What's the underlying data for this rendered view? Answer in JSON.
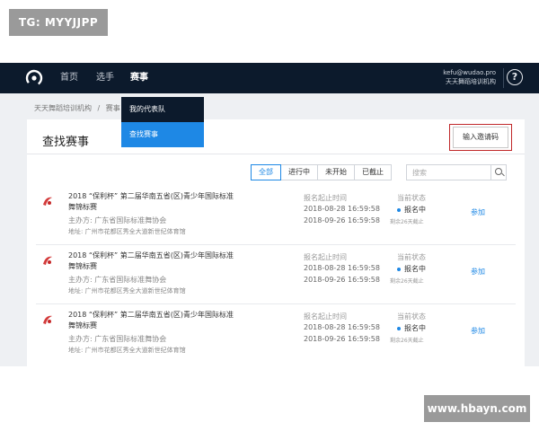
{
  "watermarks": {
    "top": "TG: MYYJJPP",
    "bottom": "www.hbayn.com"
  },
  "navbar": {
    "items": [
      "首页",
      "选手",
      "赛事"
    ],
    "user_email": "kefu@wudao.pro",
    "user_org": "天天舞蹈培训机构",
    "help_symbol": "?"
  },
  "dropdown": {
    "items": [
      "我的代表队",
      "查找赛事"
    ]
  },
  "breadcrumb": {
    "items": [
      "天天舞蹈培训机构",
      "/",
      "赛事"
    ]
  },
  "page": {
    "title": "查找赛事",
    "invite_button": "输入邀请码",
    "filters": [
      "全部",
      "进行中",
      "未开始",
      "已截止"
    ],
    "search_placeholder": "搜索"
  },
  "events": [
    {
      "title": "2018 “保利杯” 第二届华南五省(区)青少年国际标准舞锦标赛",
      "host": "主办方: 广东省国际标准舞协会",
      "address": "地址: 广州市花都区秀全大道新世纪体育馆",
      "reg_label": "报名起止时间",
      "reg_start": "2018-08-28 16:59:58",
      "reg_end": "2018-09-26 16:59:58",
      "status_label": "当前状态",
      "status": "报名中",
      "days_left": "剩余26天截止",
      "action": "参加"
    },
    {
      "title": "2018 “保利杯” 第二届华南五省(区)青少年国际标准舞锦标赛",
      "host": "主办方: 广东省国际标准舞协会",
      "address": "地址: 广州市花都区秀全大道新世纪体育馆",
      "reg_label": "报名起止时间",
      "reg_start": "2018-08-28 16:59:58",
      "reg_end": "2018-09-26 16:59:58",
      "status_label": "当前状态",
      "status": "报名中",
      "days_left": "剩余26天截止",
      "action": "参加"
    },
    {
      "title": "2018 “保利杯” 第二届华南五省(区)青少年国际标准舞锦标赛",
      "host": "主办方: 广东省国际标准舞协会",
      "address": "地址: 广州市花都区秀全大道新世纪体育馆",
      "reg_label": "报名起止时间",
      "reg_start": "2018-08-28 16:59:58",
      "reg_end": "2018-09-26 16:59:58",
      "status_label": "当前状态",
      "status": "报名中",
      "days_left": "剩余26天截止",
      "action": "参加"
    }
  ],
  "colors": {
    "nav_bg": "#0c1a2c",
    "accent": "#1e88e5",
    "highlight": "#c0282a"
  }
}
